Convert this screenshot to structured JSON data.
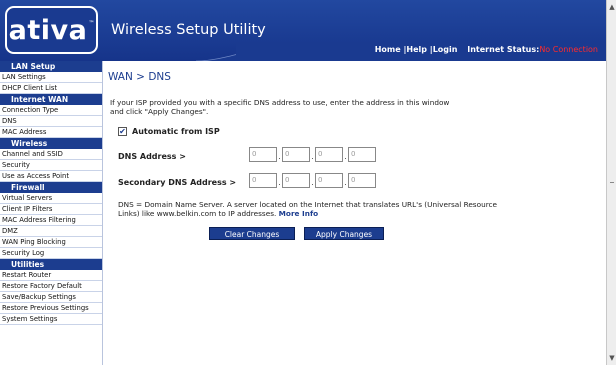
{
  "header": {
    "logo_text": "ativa",
    "logo_tm": "™",
    "app_title": "Wireless Setup Utility",
    "nav": {
      "home": "Home",
      "help": "Help",
      "login": "Login",
      "sep": "|"
    },
    "status_label": "Internet Status:",
    "status_value": "No Connection"
  },
  "sidebar": {
    "sections": [
      {
        "title": "LAN Setup",
        "items": [
          "LAN Settings",
          "DHCP Client List"
        ]
      },
      {
        "title": "Internet WAN",
        "items": [
          "Connection Type",
          "DNS",
          "MAC Address"
        ]
      },
      {
        "title": "Wireless",
        "items": [
          "Channel and SSID",
          "Security",
          "Use as Access Point"
        ]
      },
      {
        "title": "Firewall",
        "items": [
          "Virtual Servers",
          "Client IP Filters",
          "MAC Address Filtering",
          "DMZ",
          "WAN Ping Blocking",
          "Security Log"
        ]
      },
      {
        "title": "Utilities",
        "items": [
          "Restart Router",
          "Restore Factory Default",
          "Save/Backup Settings",
          "Restore Previous Settings",
          "System Settings"
        ]
      }
    ]
  },
  "main": {
    "title": "WAN > DNS",
    "intro_line1": "If your ISP provided you with a specific DNS address to use, enter the address in this window",
    "intro_line2": "and click \"Apply Changes\".",
    "auto_label": "Automatic from ISP",
    "auto_checked": true,
    "dns_label": "DNS Address >",
    "dns_values": [
      "0",
      "0",
      "0",
      "0"
    ],
    "secondary_label": "Secondary DNS Address >",
    "secondary_values": [
      "0",
      "0",
      "0",
      "0"
    ],
    "desc_text": "DNS = Domain Name Server. A server located on the Internet that translates URL's (Universal Resource Links) like www.belkin.com to IP addresses.",
    "more_info": "More Info",
    "clear_button": "Clear Changes",
    "apply_button": "Apply Changes"
  },
  "scrollbar": {
    "up_icon": "scroll-up-arrow-icon",
    "down_icon": "scroll-down-arrow-icon"
  },
  "colors": {
    "brand_blue": "#1c3d8f",
    "status_red": "#ff2a2a"
  }
}
